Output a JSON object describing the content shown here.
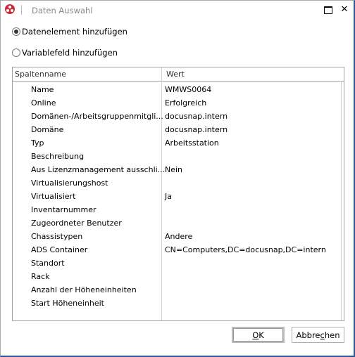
{
  "window": {
    "title": "Daten Auswahl",
    "app_icon": "docusnap-logo-icon",
    "controls": {
      "maximize_icon": "maximize-icon",
      "close_icon": "close-icon",
      "close_glyph": "✕"
    }
  },
  "options": [
    {
      "label": "Datenelement hinzufügen",
      "checked": true
    },
    {
      "label": "Variablefeld hinzufügen",
      "checked": false
    }
  ],
  "grid": {
    "columns": [
      "Spaltenname",
      "Wert"
    ],
    "rows": [
      {
        "name": "Name",
        "value": "WMWS0064"
      },
      {
        "name": "Online",
        "value": "Erfolgreich"
      },
      {
        "name": "Domänen-/Arbeitsgruppenmitgli...",
        "value": "docusnap.intern"
      },
      {
        "name": "Domäne",
        "value": "docusnap.intern"
      },
      {
        "name": "Typ",
        "value": "Arbeitsstation"
      },
      {
        "name": "Beschreibung",
        "value": ""
      },
      {
        "name": "Aus Lizenzmanagement ausschli...",
        "value": "Nein"
      },
      {
        "name": "Virtualisierungshost",
        "value": ""
      },
      {
        "name": "Virtualisiert",
        "value": "Ja"
      },
      {
        "name": "Inventarnummer",
        "value": ""
      },
      {
        "name": "Zugeordneter Benutzer",
        "value": ""
      },
      {
        "name": "Chassistypen",
        "value": "Andere"
      },
      {
        "name": "ADS Container",
        "value": "CN=Computers,DC=docusnap,DC=intern"
      },
      {
        "name": "Standort",
        "value": ""
      },
      {
        "name": "Rack",
        "value": ""
      },
      {
        "name": "Anzahl der Höheneinheiten",
        "value": ""
      },
      {
        "name": "Start Höheneinheit",
        "value": ""
      }
    ]
  },
  "buttons": {
    "ok": {
      "accel": "O",
      "rest": "K"
    },
    "cancel": {
      "pre": "Abbre",
      "accel": "c",
      "post": "hen"
    }
  }
}
